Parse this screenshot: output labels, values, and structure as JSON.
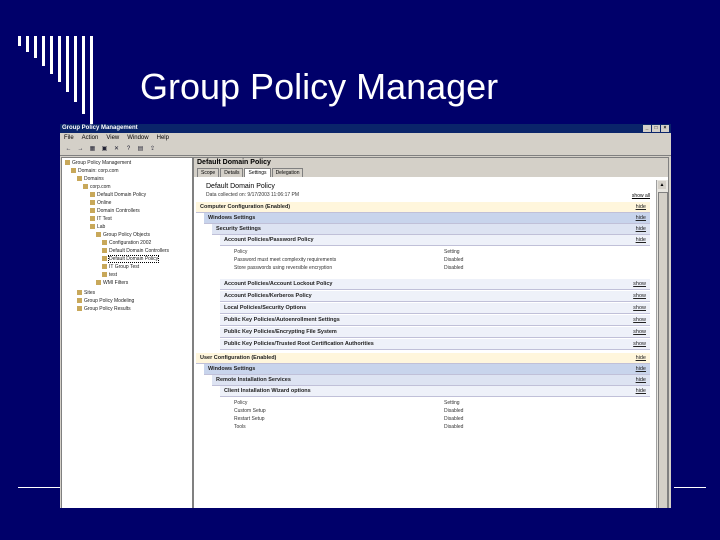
{
  "slide": {
    "title": "Group Policy Manager"
  },
  "window": {
    "title": "Group Policy Management",
    "buttons": [
      "_",
      "□",
      "×"
    ],
    "menu": [
      "File",
      "Action",
      "View",
      "Window",
      "Help"
    ],
    "toolbar": [
      "←",
      "→",
      "▦",
      "▣",
      "✕",
      "?",
      "▤",
      "⇪"
    ]
  },
  "tree": [
    "Group Policy Management",
    "Domain: corp.com",
    "Domains",
    "corp.com",
    "Default Domain Policy",
    "Online",
    "Domain Controllers",
    "IT Test",
    "Lab",
    "Group Policy Objects",
    "Configuration 2002",
    "Default Domain Controllers",
    "Default Domain Policy",
    "IT Group Test",
    "test",
    "WMI Filters",
    "Sites",
    "Group Policy Modeling",
    "Group Policy Results"
  ],
  "right": {
    "header": "Default Domain Policy",
    "tabs": [
      "Scope",
      "Details",
      "Settings",
      "Delegation"
    ],
    "active_tab": "Settings",
    "report_title": "Default Domain Policy",
    "report_date": "Data collected on: 9/17/2003 11:06:17 PM",
    "show_all": "show all",
    "rows": [
      {
        "label": "Computer Configuration (Enabled)",
        "action": "hide",
        "level": "cfg"
      },
      {
        "label": "Windows Settings",
        "action": "hide",
        "level": "l1"
      },
      {
        "label": "Security Settings",
        "action": "hide",
        "level": "l2"
      },
      {
        "label": "Account Policies/Password Policy",
        "action": "hide",
        "level": "l3"
      },
      {
        "label": "Account Policies/Account Lockout Policy",
        "action": "show",
        "level": "l3"
      },
      {
        "label": "Account Policies/Kerberos Policy",
        "action": "show",
        "level": "l3"
      },
      {
        "label": "Local Policies/Security Options",
        "action": "show",
        "level": "l3"
      },
      {
        "label": "Public Key Policies/Autoenrollment Settings",
        "action": "show",
        "level": "l3"
      },
      {
        "label": "Public Key Policies/Encrypting File System",
        "action": "show",
        "level": "l3"
      },
      {
        "label": "Public Key Policies/Trusted Root Certification Authorities",
        "action": "show",
        "level": "l3"
      },
      {
        "label": "User Configuration (Enabled)",
        "action": "hide",
        "level": "cfg"
      },
      {
        "label": "Windows Settings",
        "action": "hide",
        "level": "l1"
      },
      {
        "label": "Remote Installation Services",
        "action": "hide",
        "level": "l2"
      },
      {
        "label": "Client Installation Wizard options",
        "action": "hide",
        "level": "l3"
      }
    ],
    "password_policy": {
      "headers": [
        "Policy",
        "Setting"
      ],
      "items": [
        [
          "Password must meet complexity requirements",
          "Disabled"
        ],
        [
          "Store passwords using reversible encryption",
          "Disabled"
        ]
      ]
    },
    "ris_options": {
      "headers": [
        "Policy",
        "Setting"
      ],
      "items": [
        [
          "Custom Setup",
          "Disabled"
        ],
        [
          "Restart Setup",
          "Disabled"
        ],
        [
          "Tools",
          "Disabled"
        ]
      ]
    }
  }
}
